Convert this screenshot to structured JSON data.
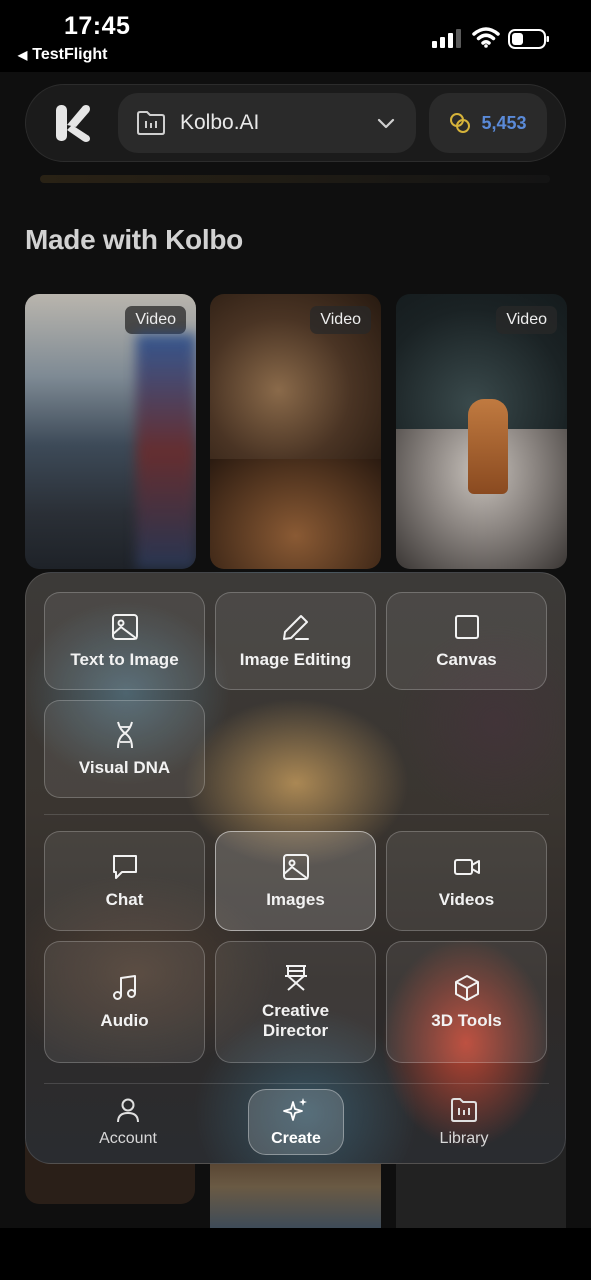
{
  "status_bar": {
    "time": "17:45",
    "back_app": "TestFlight"
  },
  "header": {
    "workspace_name": "Kolbo.AI",
    "credits": "5,453"
  },
  "section_title": "Made with Kolbo",
  "gallery": [
    {
      "badge": "Video"
    },
    {
      "badge": "Video"
    },
    {
      "badge": "Video"
    }
  ],
  "create_menu": {
    "tools": [
      {
        "label": "Text to Image",
        "icon": "image-icon"
      },
      {
        "label": "Image Editing",
        "icon": "pencil-icon"
      },
      {
        "label": "Canvas",
        "icon": "square-icon"
      },
      {
        "label": "Visual DNA",
        "icon": "dna-icon"
      }
    ],
    "modes": [
      {
        "label": "Chat",
        "icon": "chat-bubble-icon"
      },
      {
        "label": "Images",
        "icon": "image-icon",
        "active": true
      },
      {
        "label": "Videos",
        "icon": "video-camera-icon"
      },
      {
        "label": "Audio",
        "icon": "music-note-icon"
      },
      {
        "label": "Creative Director",
        "icon": "director-chair-icon"
      },
      {
        "label": "3D Tools",
        "icon": "cube-icon"
      }
    ]
  },
  "bottom_nav": {
    "account": "Account",
    "create": "Create",
    "library": "Library"
  },
  "colors": {
    "credits_text": "#5a8ad8",
    "coin_icon": "#d6b33a"
  }
}
